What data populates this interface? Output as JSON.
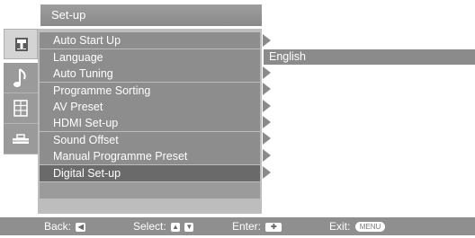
{
  "header": {
    "title": "Set-up"
  },
  "tabs": [
    {
      "icon": "picture-tab-icon"
    },
    {
      "icon": "music-note-icon"
    },
    {
      "icon": "feature-grid-icon"
    },
    {
      "icon": "setup-toolbox-icon"
    }
  ],
  "menu": {
    "items": [
      {
        "label": "Auto Start Up"
      },
      {
        "label": "Language"
      },
      {
        "label": "Auto Tuning"
      },
      {
        "label": "Programme Sorting"
      },
      {
        "label": "AV Preset"
      },
      {
        "label": "HDMI Set-up"
      },
      {
        "label": "Sound Offset"
      },
      {
        "label": "Manual Programme Preset"
      },
      {
        "label": "Digital Set-up"
      }
    ],
    "selected_index": 8
  },
  "language": {
    "value": "English"
  },
  "footer": {
    "back_label": "Back:",
    "select_label": "Select:",
    "enter_label": "Enter:",
    "exit_label": "Exit:",
    "menu_key": "MENU"
  },
  "colors": {
    "panel": "#bdbdbd",
    "row": "#8d8d8d",
    "selected_row": "#6a6a6a",
    "footer": "#8f8f8f"
  }
}
